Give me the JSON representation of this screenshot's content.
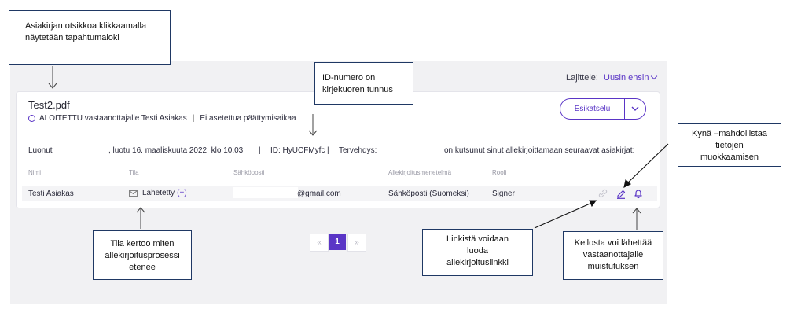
{
  "sort": {
    "label": "Lajittele:",
    "value": "Uusin ensin"
  },
  "document": {
    "title": "Test2.pdf",
    "status": "ALOITETTU",
    "status_text": "vastaanottajalle Testi Asiakas",
    "deadline": "Ei asetettua päättymisaikaa",
    "preview_label": "Esikatselu"
  },
  "info": {
    "created_label": "Luonut",
    "created_text": ", luotu 16. maaliskuuta 2022, klo 10.03",
    "id_text": "ID: HyUCFMyfc",
    "greeting_label": "Tervehdys:",
    "invite_text": "on kutsunut sinut allekirjoittamaan seuraavat asiakirjat:"
  },
  "table": {
    "headers": [
      "Nimi",
      "Tila",
      "Sähköposti",
      "Allekirjoitusmenetelmä",
      "Rooli"
    ],
    "row": {
      "name": "Testi Asiakas",
      "state": "Lähetetty",
      "state_extra": "(+)",
      "email": "@gmail.com",
      "method": "Sähköposti (Suomeksi)",
      "role": "Signer"
    }
  },
  "pagination": {
    "prev": "«",
    "current": "1",
    "next": "»"
  },
  "callouts": {
    "title_log": [
      "Asiakirjan otsikkoa klikkaamalla",
      "näytetään tapahtumaloki"
    ],
    "id_number": [
      "ID-numero on",
      "kirjekuoren tunnus"
    ],
    "pencil": [
      "Kynä –mahdollistaa",
      "tietojen",
      "muokkaamisen"
    ],
    "state": [
      "Tila kertoo miten",
      "allekirjoitusprosessi",
      "etenee"
    ],
    "link": [
      "Linkistä voidaan",
      "luoda",
      "allekirjoituslinkki"
    ],
    "bell": [
      "Kellosta voi lähettää",
      "vastaanottajalle",
      "muistutuksen"
    ]
  },
  "colors": {
    "accent": "#5a35c6",
    "callout_border": "#1f3864",
    "panel_bg": "#f1f1f3"
  },
  "icons": [
    "envelope-icon",
    "link-icon",
    "pencil-icon",
    "bell-icon",
    "chevron-down-icon",
    "status-ring-icon"
  ]
}
